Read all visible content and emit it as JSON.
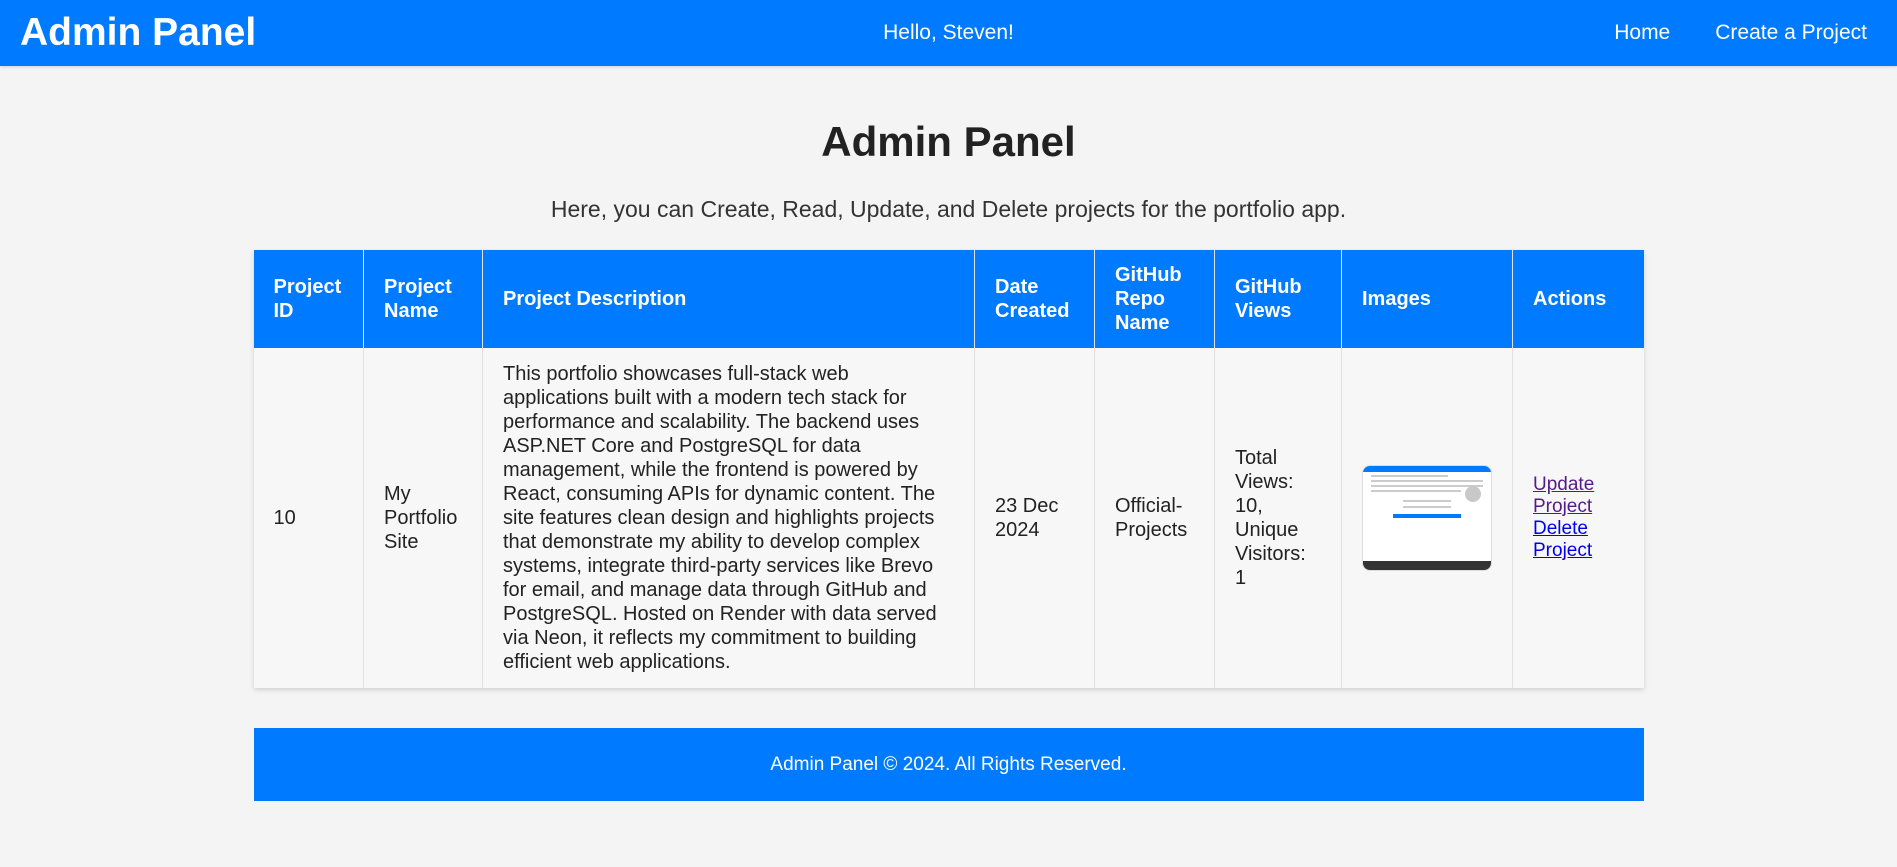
{
  "header": {
    "brand": "Admin Panel",
    "greeting": "Hello, Steven!",
    "nav": [
      {
        "label": "Home"
      },
      {
        "label": "Create a Project"
      }
    ]
  },
  "main": {
    "title": "Admin Panel",
    "subtitle": "Here, you can Create, Read, Update, and Delete projects for the portfolio app."
  },
  "table": {
    "headers": [
      "Project ID",
      "Project Name",
      "Project Description",
      "Date Created",
      "GitHub Repo Name",
      "GitHub Views",
      "Images",
      "Actions"
    ],
    "rows": [
      {
        "id": "10",
        "name": "My Portfolio Site",
        "description": "This portfolio showcases full-stack web applications built with a modern tech stack for performance and scalability. The backend uses ASP.NET Core and PostgreSQL for data management, while the frontend is powered by React, consuming APIs for dynamic content. The site features clean design and highlights projects that demonstrate my ability to develop complex systems, integrate third-party services like Brevo for email, and manage data through GitHub and PostgreSQL. Hosted on Render with data served via Neon, it reflects my commitment to building efficient web applications.",
        "date": "23 Dec 2024",
        "repo": "Official-Projects",
        "views": "Total Views: 10, Unique Visitors: 1",
        "image_icon": "project-screenshot-thumbnail",
        "actions": {
          "update": "Update Project",
          "delete": "Delete Project"
        }
      }
    ]
  },
  "footer": {
    "text": "Admin Panel © 2024. All Rights Reserved."
  },
  "colors": {
    "primary": "#007bff",
    "background": "#f4f4f4"
  }
}
